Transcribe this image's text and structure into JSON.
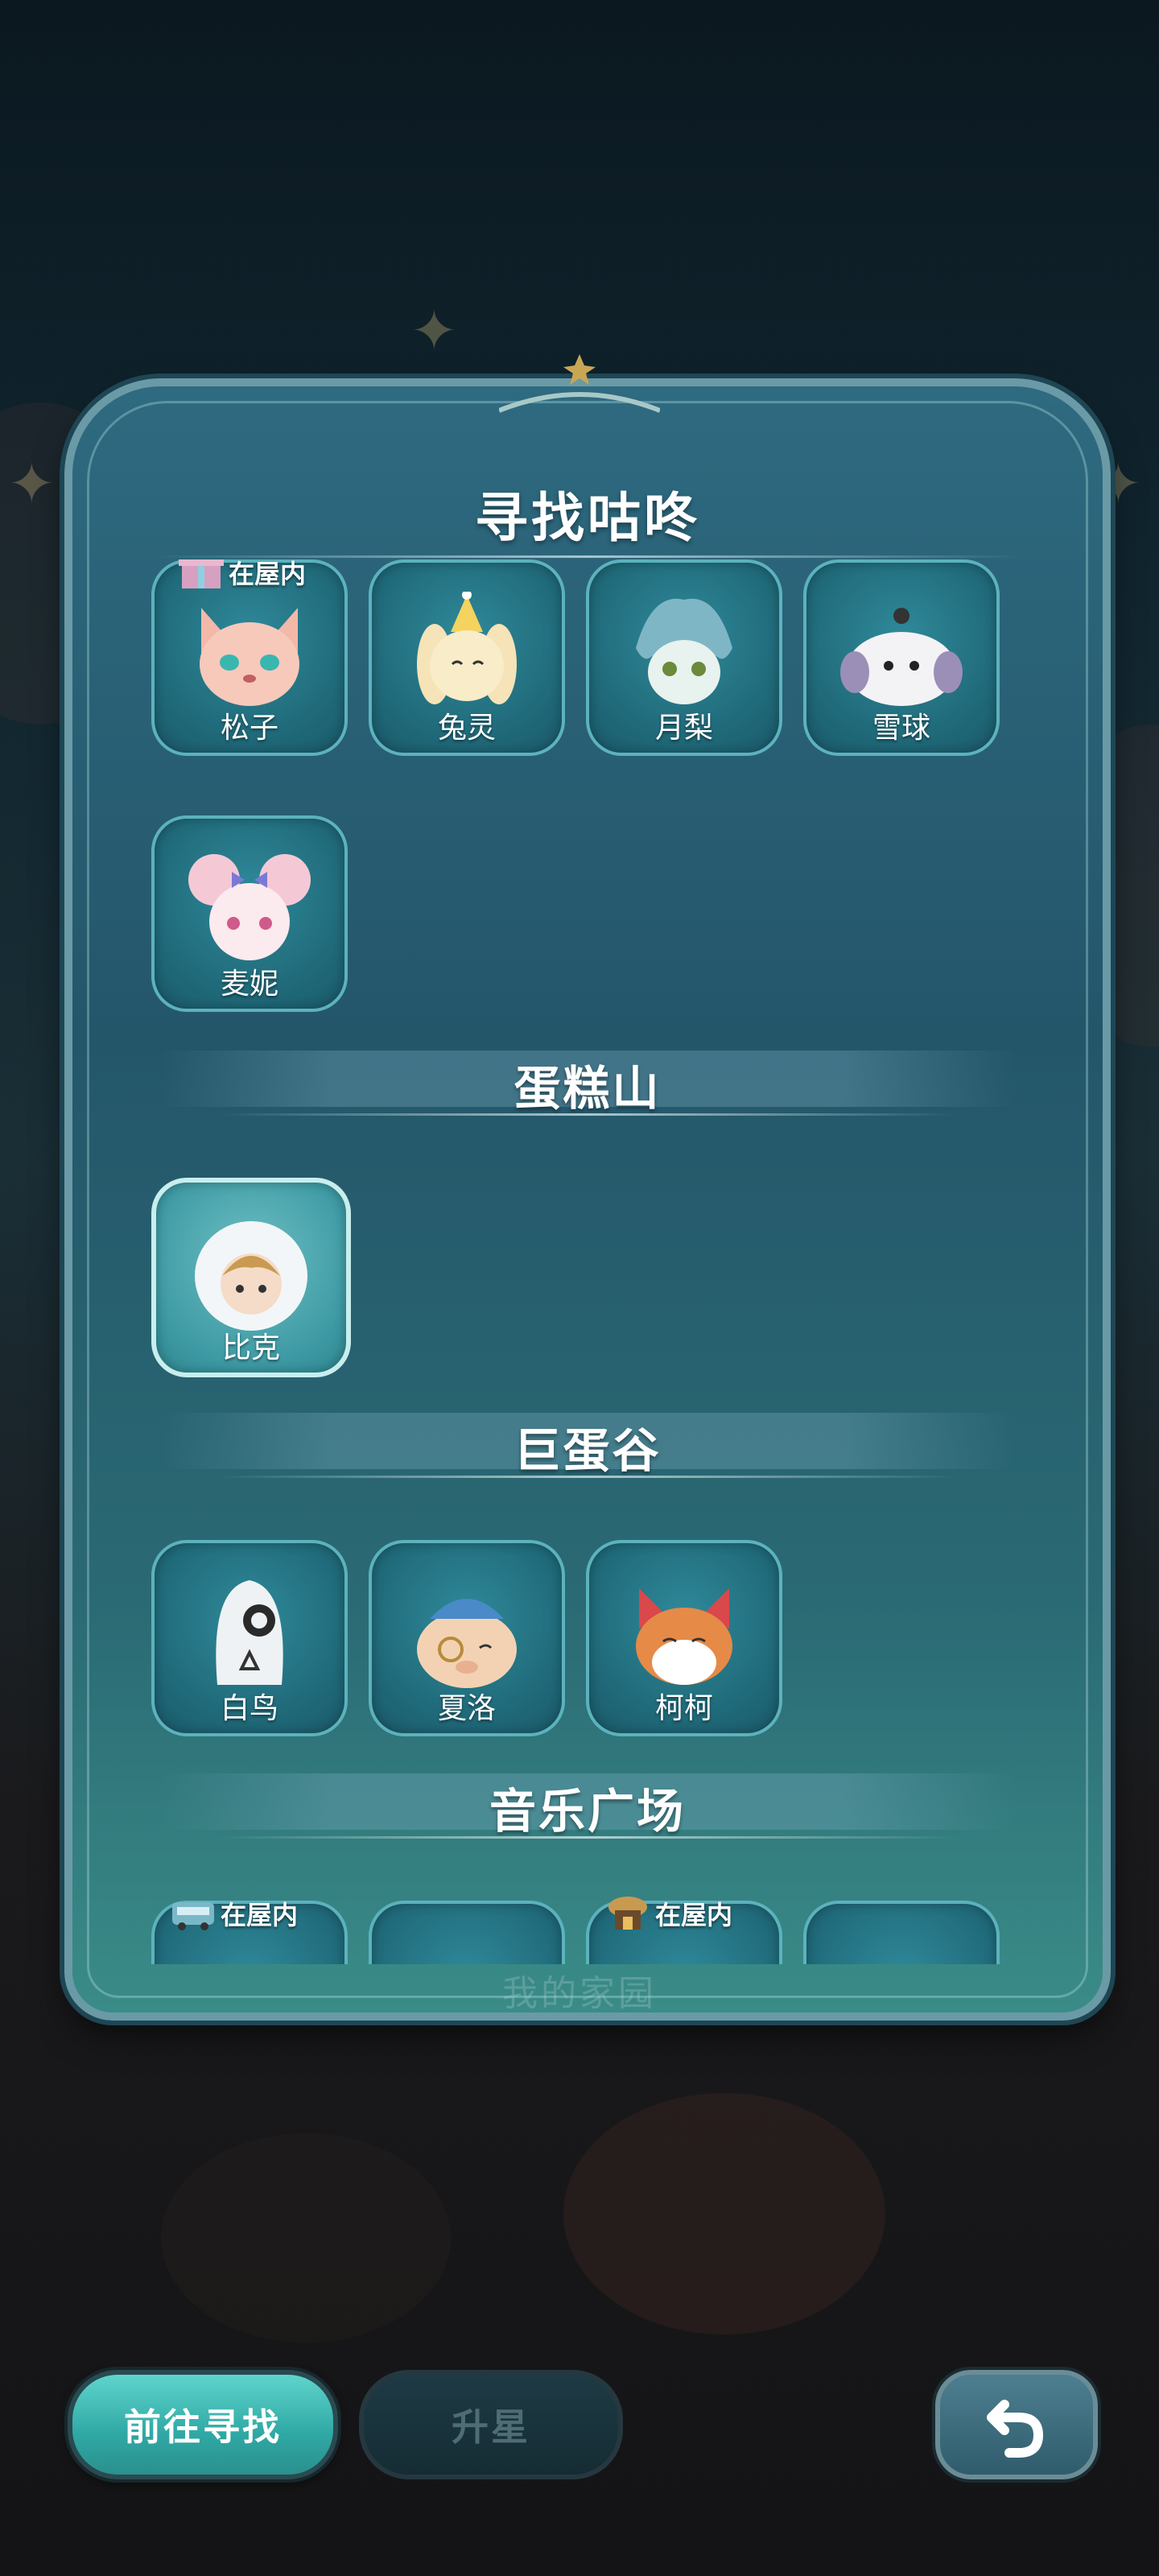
{
  "panel": {
    "title": "寻找咕咚"
  },
  "sections": [
    {
      "title": "",
      "characters": [
        {
          "name": "松子",
          "in_house": true
        },
        {
          "name": "兔灵",
          "in_house": false
        },
        {
          "name": "月梨",
          "in_house": false
        },
        {
          "name": "雪球",
          "in_house": false
        },
        {
          "name": "麦妮",
          "in_house": false
        }
      ]
    },
    {
      "title": "蛋糕山",
      "characters": [
        {
          "name": "比克",
          "in_house": false,
          "selected": true
        }
      ]
    },
    {
      "title": "巨蛋谷",
      "characters": [
        {
          "name": "白鸟",
          "in_house": false
        },
        {
          "name": "夏洛",
          "in_house": false
        },
        {
          "name": "柯柯",
          "in_house": false
        }
      ]
    },
    {
      "title": "音乐广场",
      "characters": [
        {
          "name": "",
          "in_house": true
        },
        {
          "name": "",
          "in_house": false
        },
        {
          "name": "",
          "in_house": true
        },
        {
          "name": "",
          "in_house": false
        }
      ]
    }
  ],
  "in_house_label": "在屋内",
  "background_label": "我的家园",
  "buttons": {
    "go_find": "前往寻找",
    "star_up": "升星",
    "back_icon": "return-arrow-icon"
  },
  "colors": {
    "panel": "#2a6474",
    "accent": "#3fbfba",
    "card_border": "#5cb2bd"
  }
}
